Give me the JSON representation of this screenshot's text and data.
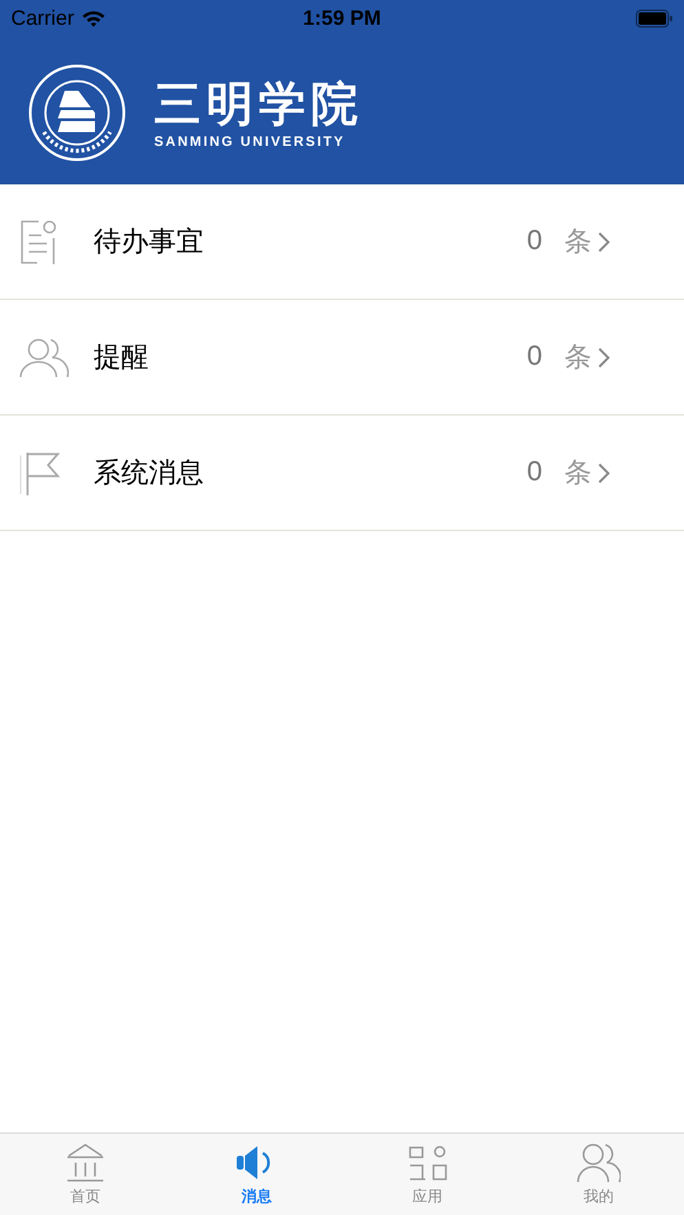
{
  "status_bar": {
    "carrier": "Carrier",
    "time": "1:59 PM"
  },
  "header": {
    "title": "三明学院",
    "subtitle": "SANMING UNIVERSITY"
  },
  "rows": [
    {
      "kind": "todo",
      "label": "待办事宜",
      "count": "0",
      "unit": "条"
    },
    {
      "kind": "people",
      "label": "提醒",
      "count": "0",
      "unit": "条"
    },
    {
      "kind": "flag",
      "label": "系统消息",
      "count": "0",
      "unit": "条"
    }
  ],
  "tabs": [
    {
      "kind": "home",
      "label": "首页",
      "selected": false
    },
    {
      "kind": "message",
      "label": "消息",
      "selected": true
    },
    {
      "kind": "apps",
      "label": "应用",
      "selected": false
    },
    {
      "kind": "me",
      "label": "我的",
      "selected": false
    }
  ]
}
